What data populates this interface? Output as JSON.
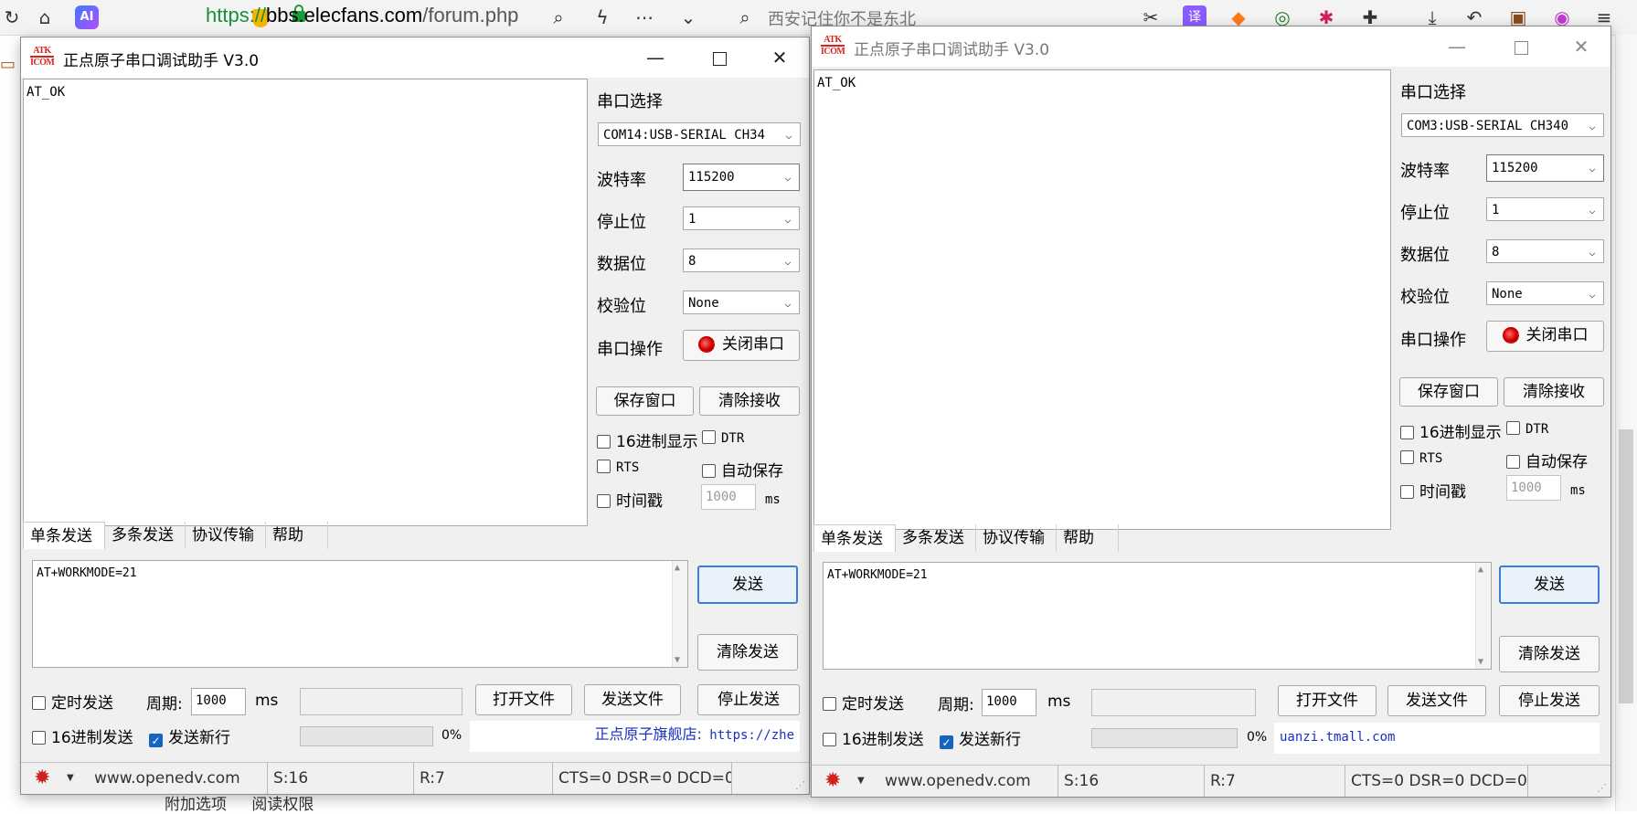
{
  "browser": {
    "url_scheme": "https://",
    "url_host": "bbs.elecfans.com",
    "url_path": "/forum.php",
    "search_text": "西安记住你不是东北",
    "page_links": [
      "附加选项",
      "阅读权限"
    ]
  },
  "windows": [
    {
      "title": "正点原子串口调试助手 V3.0",
      "logo_top": "ATK",
      "logo_bottom": "ICOM",
      "receive_text": "AT_OK",
      "port_label": "串口选择",
      "port_value": "COM14:USB-SERIAL CH34",
      "baud_label": "波特率",
      "baud_value": "115200",
      "stop_label": "停止位",
      "stop_value": "1",
      "data_label": "数据位",
      "data_value": "8",
      "parity_label": "校验位",
      "parity_value": "None",
      "op_label": "串口操作",
      "close_port_label": "关闭串口",
      "save_window_label": "保存窗口",
      "clear_recv_label": "清除接收",
      "hex_display_label": "16进制显示",
      "dtr_label": "DTR",
      "rts_label": "RTS",
      "autosave_label": "自动保存",
      "timestamp_label": "时间戳",
      "timestamp_ms": "1000",
      "ms_label": "ms",
      "tabs": [
        "单条发送",
        "多条发送",
        "协议传输",
        "帮助"
      ],
      "send_text": "AT+WORKMODE=21",
      "send_label": "发送",
      "clear_send_label": "清除发送",
      "timed_send_label": "定时发送",
      "period_label": "周期:",
      "period_value": "1000",
      "period_unit": "ms",
      "open_file_label": "打开文件",
      "send_file_label": "发送文件",
      "stop_send_label": "停止发送",
      "hex_send_label": "16进制发送",
      "newline_label": "发送新行",
      "progress_pct": "0%",
      "shop_cn": "正点原子旗舰店:",
      "shop_url": "https://zhe",
      "status_site": "www.openedv.com",
      "status_s": "S:16",
      "status_r": "R:7",
      "status_lines": "CTS=0 DSR=0 DCD=0"
    },
    {
      "title": "正点原子串口调试助手 V3.0",
      "logo_top": "ATK",
      "logo_bottom": "ICOM",
      "receive_text": "AT_OK",
      "port_label": "串口选择",
      "port_value": "COM3:USB-SERIAL CH340",
      "baud_label": "波特率",
      "baud_value": "115200",
      "stop_label": "停止位",
      "stop_value": "1",
      "data_label": "数据位",
      "data_value": "8",
      "parity_label": "校验位",
      "parity_value": "None",
      "op_label": "串口操作",
      "close_port_label": "关闭串口",
      "save_window_label": "保存窗口",
      "clear_recv_label": "清除接收",
      "hex_display_label": "16进制显示",
      "dtr_label": "DTR",
      "rts_label": "RTS",
      "autosave_label": "自动保存",
      "timestamp_label": "时间戳",
      "timestamp_ms": "1000",
      "ms_label": "ms",
      "tabs": [
        "单条发送",
        "多条发送",
        "协议传输",
        "帮助"
      ],
      "send_text": "AT+WORKMODE=21",
      "send_label": "发送",
      "clear_send_label": "清除发送",
      "timed_send_label": "定时发送",
      "period_label": "周期:",
      "period_value": "1000",
      "period_unit": "ms",
      "open_file_label": "打开文件",
      "send_file_label": "发送文件",
      "stop_send_label": "停止发送",
      "hex_send_label": "16进制发送",
      "newline_label": "发送新行",
      "progress_pct": "0%",
      "shop_cn": "",
      "shop_url": "uanzi.tmall.com",
      "status_site": "www.openedv.com",
      "status_s": "S:16",
      "status_r": "R:7",
      "status_lines": "CTS=0 DSR=0 DCD=0"
    }
  ]
}
